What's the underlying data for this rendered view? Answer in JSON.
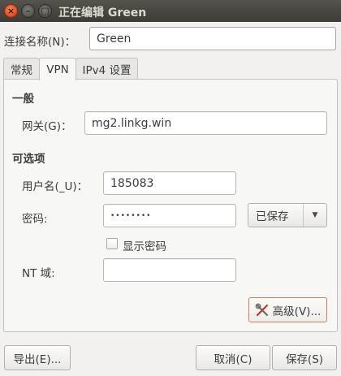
{
  "window": {
    "title": "正在编辑 Green"
  },
  "connection": {
    "name_label": "连接名称(N)：",
    "name_value": "Green"
  },
  "tabs": [
    {
      "label": "常规"
    },
    {
      "label": "VPN"
    },
    {
      "label": "IPv4 设置"
    }
  ],
  "general": {
    "section_title": "一般",
    "gateway_label": "网关(G)：",
    "gateway_value": "mg2.linkg.win"
  },
  "optional": {
    "section_title": "可选项",
    "username_label": "用户名(_U)：",
    "username_value": "185083",
    "password_label": "密码:",
    "password_dots": "••••••••",
    "password_store_option": "已保存",
    "show_password_label": "显示密码",
    "nt_domain_label": "NT 域:",
    "nt_domain_value": "",
    "advanced_button": "高级(V)..."
  },
  "footer": {
    "export_button": "导出(E)...",
    "cancel_button": "取消(C)",
    "save_button": "保存(S)"
  }
}
